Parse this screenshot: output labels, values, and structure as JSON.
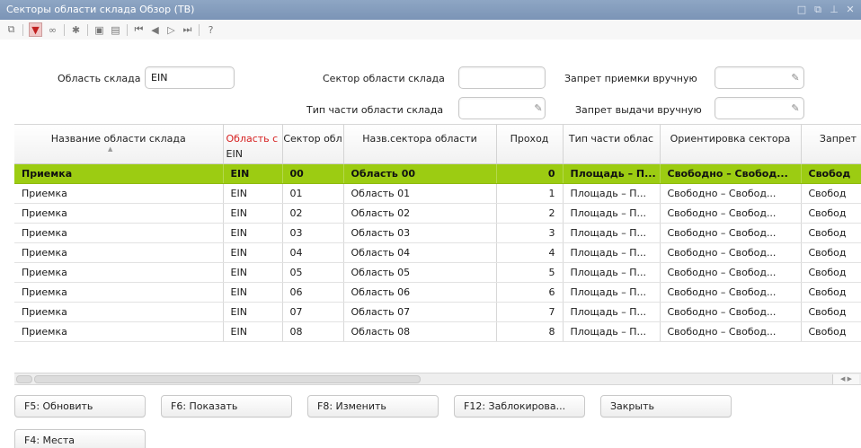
{
  "window": {
    "title": "Секторы области склада Обзор (ТВ)"
  },
  "filters": {
    "area_label": "Область склада",
    "area_value": "EIN",
    "sector_label": "Сектор области склада",
    "sector_value": "",
    "area_part_type_label": "Тип части области склада",
    "area_part_type_value": "",
    "receipt_block_label": "Запрет приемки вручную",
    "receipt_block_value": "",
    "issue_block_label": "Запрет выдачи вручную",
    "issue_block_value": ""
  },
  "table": {
    "columns": [
      {
        "label": "Название области склада"
      },
      {
        "label": "Область с",
        "sub": "EIN"
      },
      {
        "label": "Сектор обл"
      },
      {
        "label": "Назв.сектора области"
      },
      {
        "label": "Проход"
      },
      {
        "label": "Тип части облас"
      },
      {
        "label": "Ориентировка сектора"
      },
      {
        "label": "Запрет"
      }
    ],
    "rows": [
      [
        "Приемка",
        "EIN",
        "00",
        "Область 00",
        "0",
        "Площадь – П...",
        "Свободно – Свобод...",
        "Свобод"
      ],
      [
        "Приемка",
        "EIN",
        "01",
        "Область 01",
        "1",
        "Площадь – П...",
        "Свободно – Свобод...",
        "Свобод"
      ],
      [
        "Приемка",
        "EIN",
        "02",
        "Область 02",
        "2",
        "Площадь – П...",
        "Свободно – Свобод...",
        "Свобод"
      ],
      [
        "Приемка",
        "EIN",
        "03",
        "Область 03",
        "3",
        "Площадь – П...",
        "Свободно – Свобод...",
        "Свобод"
      ],
      [
        "Приемка",
        "EIN",
        "04",
        "Область 04",
        "4",
        "Площадь – П...",
        "Свободно – Свобод...",
        "Свобод"
      ],
      [
        "Приемка",
        "EIN",
        "05",
        "Область 05",
        "5",
        "Площадь – П...",
        "Свободно – Свобод...",
        "Свобод"
      ],
      [
        "Приемка",
        "EIN",
        "06",
        "Область 06",
        "6",
        "Площадь – П...",
        "Свободно – Свобод...",
        "Свобод"
      ],
      [
        "Приемка",
        "EIN",
        "07",
        "Область 07",
        "7",
        "Площадь – П...",
        "Свободно – Свобод...",
        "Свобод"
      ],
      [
        "Приемка",
        "EIN",
        "08",
        "Область 08",
        "8",
        "Площадь – П...",
        "Свободно – Свобод...",
        "Свобод"
      ]
    ],
    "selected_row": 0
  },
  "buttons": {
    "refresh": "F5: Обновить",
    "show": "F6: Показать",
    "edit": "F8: Изменить",
    "block": "F12: Заблокирова...",
    "close": "Закрыть",
    "places": "F4: Места"
  },
  "colors": {
    "titlebar": "#8ea6c4",
    "selection": "#9ccc12",
    "required_header": "#d62020"
  },
  "icons": {
    "toolbar": [
      "copy-icon",
      "filter-icon",
      "binoculars-icon",
      "settings-icon",
      "export-icon",
      "layout-icon",
      "first-record-icon",
      "previous-record-icon",
      "next-record-icon",
      "last-record-icon",
      "help-icon"
    ]
  }
}
